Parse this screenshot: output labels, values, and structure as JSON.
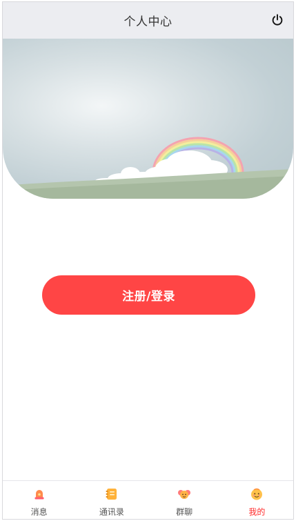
{
  "header": {
    "title": "个人中心",
    "power_icon": "power-icon"
  },
  "banner": {
    "image_icon": "sky-rainbow-illustration"
  },
  "main": {
    "login_label": "注册/登录"
  },
  "tabbar": {
    "active_color": "#ff2a2a",
    "items": [
      {
        "label": "消息",
        "icon": "alarm-bell-icon"
      },
      {
        "label": "通讯录",
        "icon": "notebook-icon"
      },
      {
        "label": "群聊",
        "icon": "group-icon"
      },
      {
        "label": "我的",
        "icon": "smiley-face-icon",
        "active": true
      }
    ]
  },
  "colors": {
    "header_bg": "#ecedf1",
    "accent": "#ff4545"
  }
}
